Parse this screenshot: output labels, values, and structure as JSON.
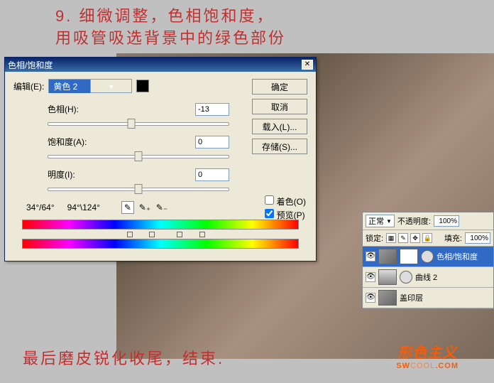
{
  "annotations": {
    "top_line1": "9. 细微调整，色相饱和度，",
    "top_line2": "用吸管吸选背景中的绿色部份",
    "bottom": "最后磨皮锐化收尾，结束."
  },
  "watermark": {
    "cn": "形色主义",
    "en_prefix": "SW",
    "en_mid": "COOL",
    "en_suffix": ".COM"
  },
  "dialog": {
    "title": "色相/饱和度",
    "edit_label": "编辑(E):",
    "edit_value": "黄色 2",
    "hue": {
      "label": "色相(H):",
      "value": "-13",
      "pos": 46
    },
    "sat": {
      "label": "饱和度(A):",
      "value": "0",
      "pos": 50
    },
    "light": {
      "label": "明度(I):",
      "value": "0",
      "pos": 50
    },
    "buttons": {
      "ok": "确定",
      "cancel": "取消",
      "load": "载入(L)...",
      "save": "存储(S)..."
    },
    "range_left": "34°/64°",
    "range_right": "94°\\124°",
    "colorize": "着色(O)",
    "preview": "预览(P)"
  },
  "layers": {
    "blend": "正常",
    "opacity_label": "不透明度:",
    "opacity_value": "100%",
    "lock_label": "锁定:",
    "fill_label": "填充:",
    "fill_value": "100%",
    "items": [
      {
        "name": "色相/饱和度",
        "selected": true
      },
      {
        "name": "曲线 2",
        "selected": false
      },
      {
        "name": "盖印层",
        "selected": false
      }
    ]
  }
}
